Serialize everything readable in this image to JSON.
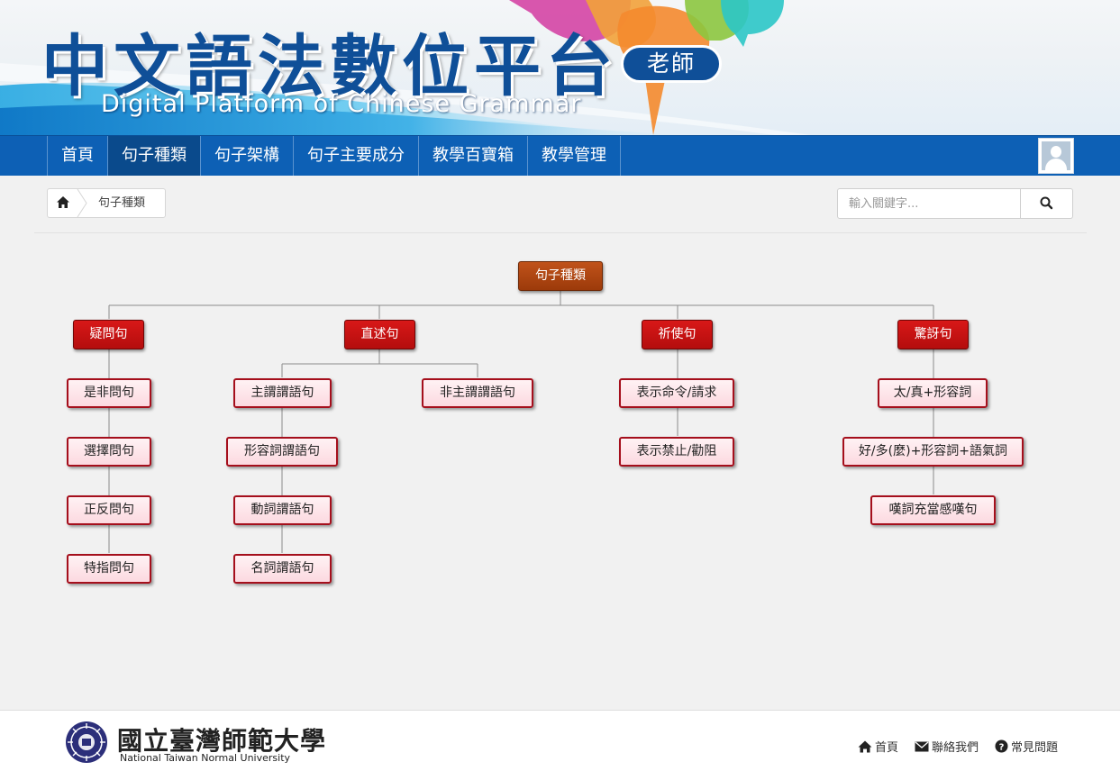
{
  "header": {
    "title": "中文語法數位平台",
    "subtitle": "Digital Platform of Chinese Grammar",
    "role_badge": "老師"
  },
  "nav": {
    "items": [
      {
        "label": "首頁",
        "active": false
      },
      {
        "label": "句子種類",
        "active": true
      },
      {
        "label": "句子架構",
        "active": false
      },
      {
        "label": "句子主要成分",
        "active": false
      },
      {
        "label": "教學百寶箱",
        "active": false
      },
      {
        "label": "教學管理",
        "active": false
      }
    ],
    "avatar_icon": "user-avatar-icon"
  },
  "breadcrumb": {
    "home_icon": "home-icon",
    "current": "句子種類"
  },
  "search": {
    "placeholder": "輸入關鍵字...",
    "button_icon": "search-icon"
  },
  "tree": {
    "root": "句子種類",
    "categories": {
      "question": "疑問句",
      "declarative": "直述句",
      "imperative": "祈使句",
      "exclamatory": "驚訝句"
    },
    "question_types": [
      "是非問句",
      "選擇問句",
      "正反問句",
      "特指問句"
    ],
    "declarative_types": {
      "subject_predicate": "主謂謂語句",
      "non_subject_predicate": "非主謂謂語句",
      "sub": [
        "形容詞謂語句",
        "動詞謂語句",
        "名詞謂語句"
      ]
    },
    "imperative_types": [
      "表示命令/請求",
      "表示禁止/勸阻"
    ],
    "exclamatory_types": [
      "太/真+形容詞",
      "好/多(麼)+形容詞+語氣詞",
      "嘆詞充當感嘆句"
    ]
  },
  "footer": {
    "university_cn": "國立臺灣師範大學",
    "university_en": "National Taiwan Normal University",
    "links": [
      {
        "label": "首頁",
        "icon": "home-icon"
      },
      {
        "label": "聯絡我們",
        "icon": "envelope-icon"
      },
      {
        "label": "常見問題",
        "icon": "question-circle-icon"
      }
    ]
  },
  "colors": {
    "nav_bg": "#0d60b5",
    "nav_active": "#0a4a8c",
    "title_blue": "#0f4f98",
    "root_node": "#b04818",
    "category_node": "#c81212",
    "leaf_fill": "#fde4ea",
    "leaf_border": "#a50f1c"
  }
}
